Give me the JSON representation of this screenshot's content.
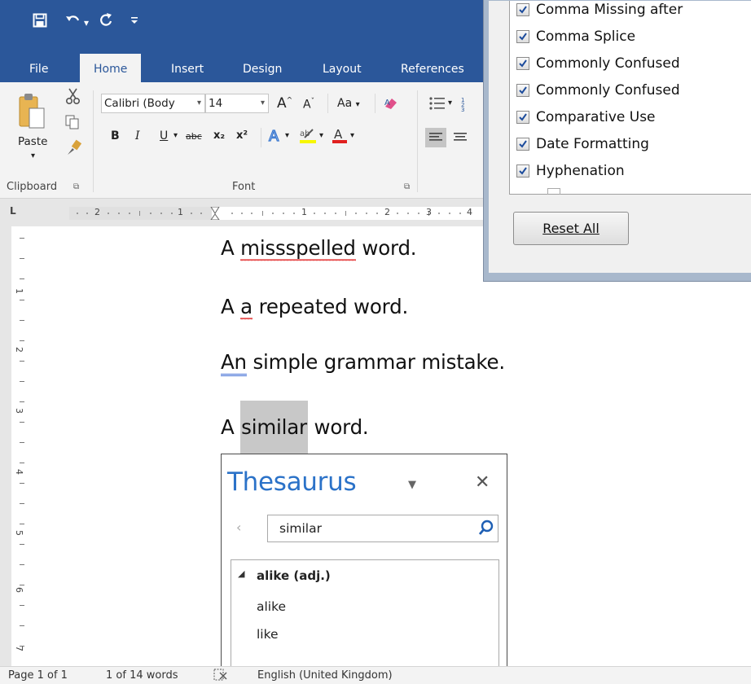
{
  "quick_access": {
    "save_icon": "save-icon",
    "undo_icon": "undo-icon",
    "redo_icon": "redo-icon",
    "customize_icon": "customize-qat-icon"
  },
  "tabs": [
    "File",
    "Home",
    "Insert",
    "Design",
    "Layout",
    "References"
  ],
  "ribbon": {
    "clipboard": {
      "label": "Clipboard",
      "paste": "Paste"
    },
    "font": {
      "label": "Font",
      "font_name": "Calibri (Body",
      "font_size": "14",
      "case_label": "Aa",
      "bold": "B",
      "italic": "I",
      "underline": "U",
      "strikethrough": "abc",
      "subscript": "x₂",
      "superscript": "x²",
      "grow": "A",
      "shrink": "A"
    }
  },
  "ruler": {
    "corner": "L",
    "h_numbers": [
      "2",
      "1",
      "1",
      "2",
      "3",
      "4"
    ],
    "v_numbers": [
      "1",
      "2",
      "3",
      "4",
      "5",
      "6",
      "7"
    ]
  },
  "document": {
    "lines": [
      {
        "before": "A ",
        "flag": "missspelled",
        "after": " word."
      },
      {
        "before": "A ",
        "flag": "a",
        "after": " repeated word."
      },
      {
        "before": "",
        "flag": "An",
        "after": " simple grammar mistake."
      },
      {
        "before": "A ",
        "flag": "similar",
        "after": " word."
      }
    ]
  },
  "thesaurus": {
    "title": "Thesaurus",
    "search_value": "similar",
    "results": {
      "header": "alike (adj.)",
      "items": [
        "alike",
        "like"
      ]
    }
  },
  "dialog": {
    "rules": [
      "Comma Missing after",
      "Comma Splice",
      "Commonly Confused",
      "Commonly Confused",
      "Comparative Use",
      "Date Formatting",
      "Hyphenation"
    ],
    "reset_button": "Reset All"
  },
  "status": {
    "page": "Page 1 of 1",
    "words": "1 of 14 words",
    "proofing_icon": "proofing-icon",
    "language": "English (United Kingdom)"
  },
  "colors": {
    "accent": "#2b579a",
    "thesaurus_title": "#2b72c8",
    "spelling_error": "#e02020",
    "grammar_error": "#3d6bd4"
  }
}
